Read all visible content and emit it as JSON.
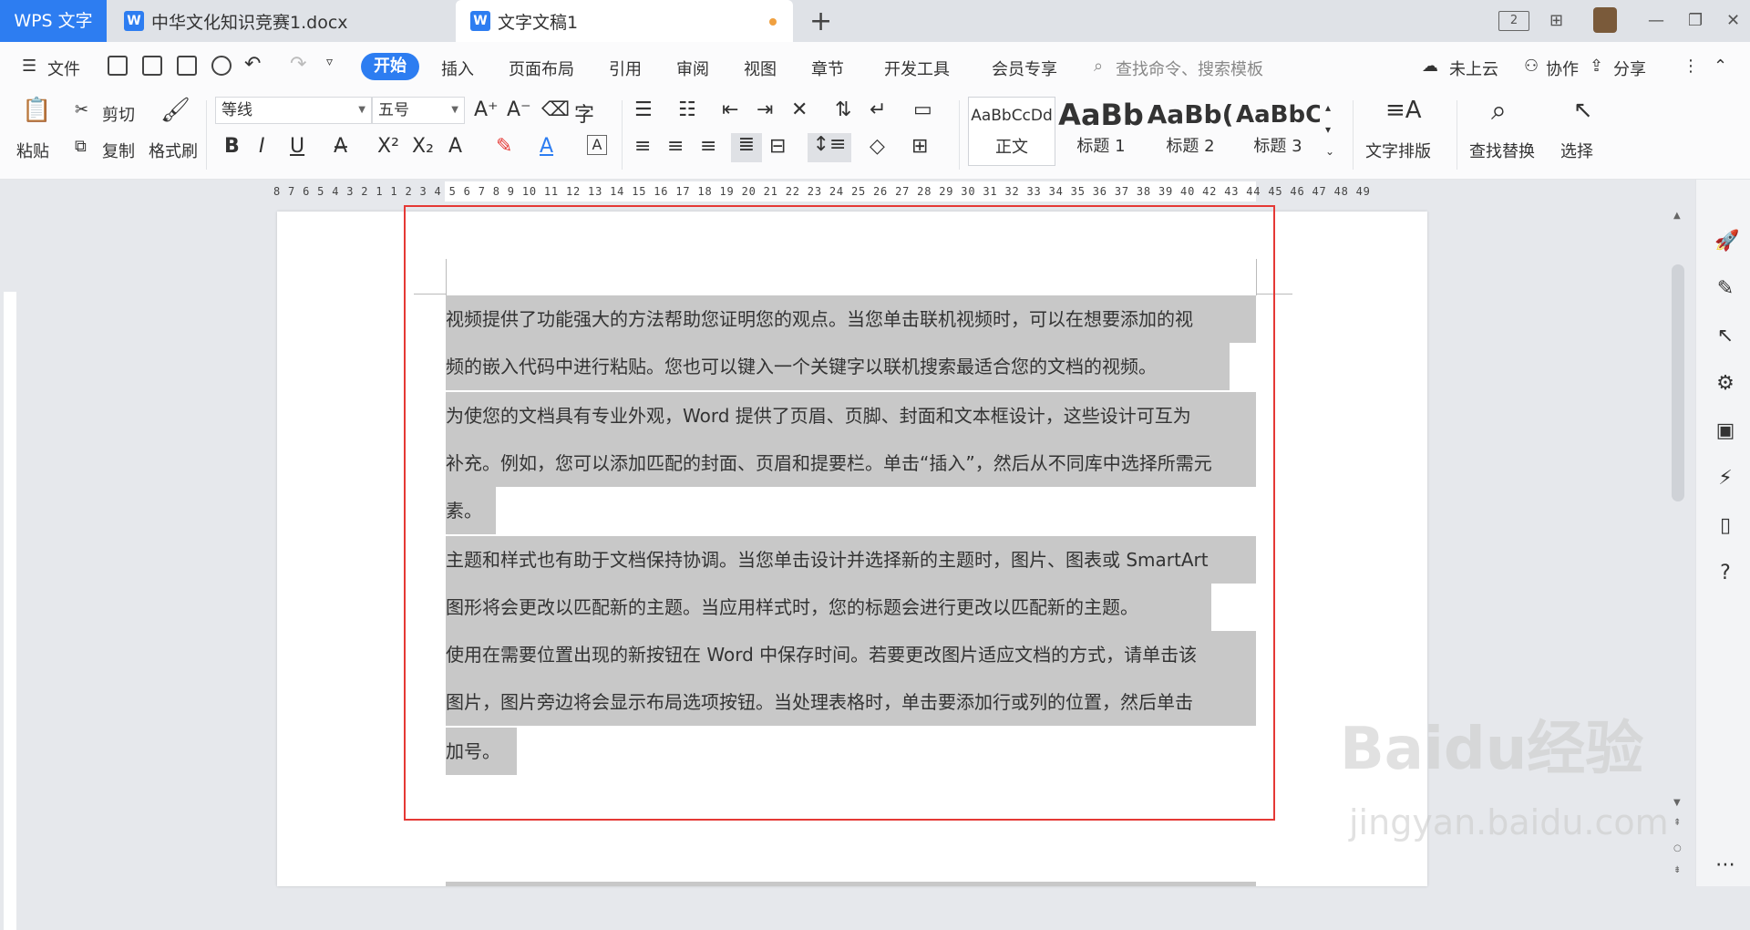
{
  "tabs": {
    "app": "WPS 文字",
    "doc1": "中华文化知识竞赛1.docx",
    "doc2": "文字文稿1",
    "badge": "2"
  },
  "menu": {
    "file": "文件",
    "items": [
      "开始",
      "插入",
      "页面布局",
      "引用",
      "审阅",
      "视图",
      "章节",
      "开发工具",
      "会员专享"
    ],
    "search_placeholder": "查找命令、搜索模板",
    "cloud": "未上云",
    "collab": "协作",
    "share": "分享"
  },
  "ribbon": {
    "paste": "粘贴",
    "cut": "剪切",
    "copy": "复制",
    "format_painter": "格式刷",
    "font": "等线",
    "size": "五号",
    "styles": [
      {
        "preview": "AaBbCcDd",
        "name": "正文"
      },
      {
        "preview": "AaBb",
        "name": "标题 1"
      },
      {
        "preview": "AaBb(",
        "name": "标题 2"
      },
      {
        "preview": "AaBbC",
        "name": "标题 3"
      }
    ],
    "text_layout": "文字排版",
    "find_replace": "查找替换",
    "select": "选择"
  },
  "ruler": {
    "numbers": "8  7  6  5  4  3  2  1     1  2  3  4  5  6  7  8  9 10 11 12 13 14 15 16 17 18 19 20 21 22 23 24 25 26 27 28 29 30 31 32 33 34 35 36 37 38 39 40  42 43 44 45 46 47 48 49"
  },
  "document": {
    "lines": [
      "视频提供了功能强大的方法帮助您证明您的观点。当您单击联机视频时，可以在想要添加的视",
      "频的嵌入代码中进行粘贴。您也可以键入一个关键字以联机搜索最适合您的文档的视频。",
      "为使您的文档具有专业外观，Word 提供了页眉、页脚、封面和文本框设计，这些设计可互为",
      "补充。例如，您可以添加匹配的封面、页眉和提要栏。单击“插入”，然后从不同库中选择所需元",
      "素。",
      "主题和样式也有助于文档保持协调。当您单击设计并选择新的主题时，图片、图表或 SmartArt",
      "图形将会更改以匹配新的主题。当应用样式时，您的标题会进行更改以匹配新的主题。",
      "使用在需要位置出现的新按钮在 Word 中保存时间。若要更改图片适应文档的方式，请单击该",
      "图片，图片旁边将会显示布局选项按钮。当处理表格时，单击要添加行或列的位置，然后单击",
      "加号。"
    ]
  },
  "watermark": {
    "logo": "Baidu经验",
    "url": "jingyan.baidu.com"
  },
  "colors": {
    "accent": "#2d7df1",
    "selection": "#c8c8c8",
    "frame": "#e53935"
  }
}
